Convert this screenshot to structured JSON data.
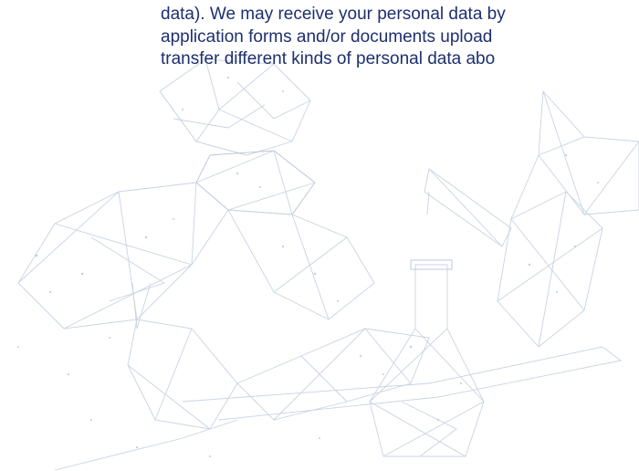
{
  "privacy_text": {
    "lines": [
      "data). We may receive your personal data by",
      "application forms and/or documents upload",
      "transfer different kinds of personal data abo"
    ]
  },
  "illustration": {
    "icon": "scientist-lab-mesh-illustration",
    "stroke_color": "#c9d3e3"
  },
  "colors": {
    "text": "#1d2f6f",
    "background": "#ffffff"
  }
}
